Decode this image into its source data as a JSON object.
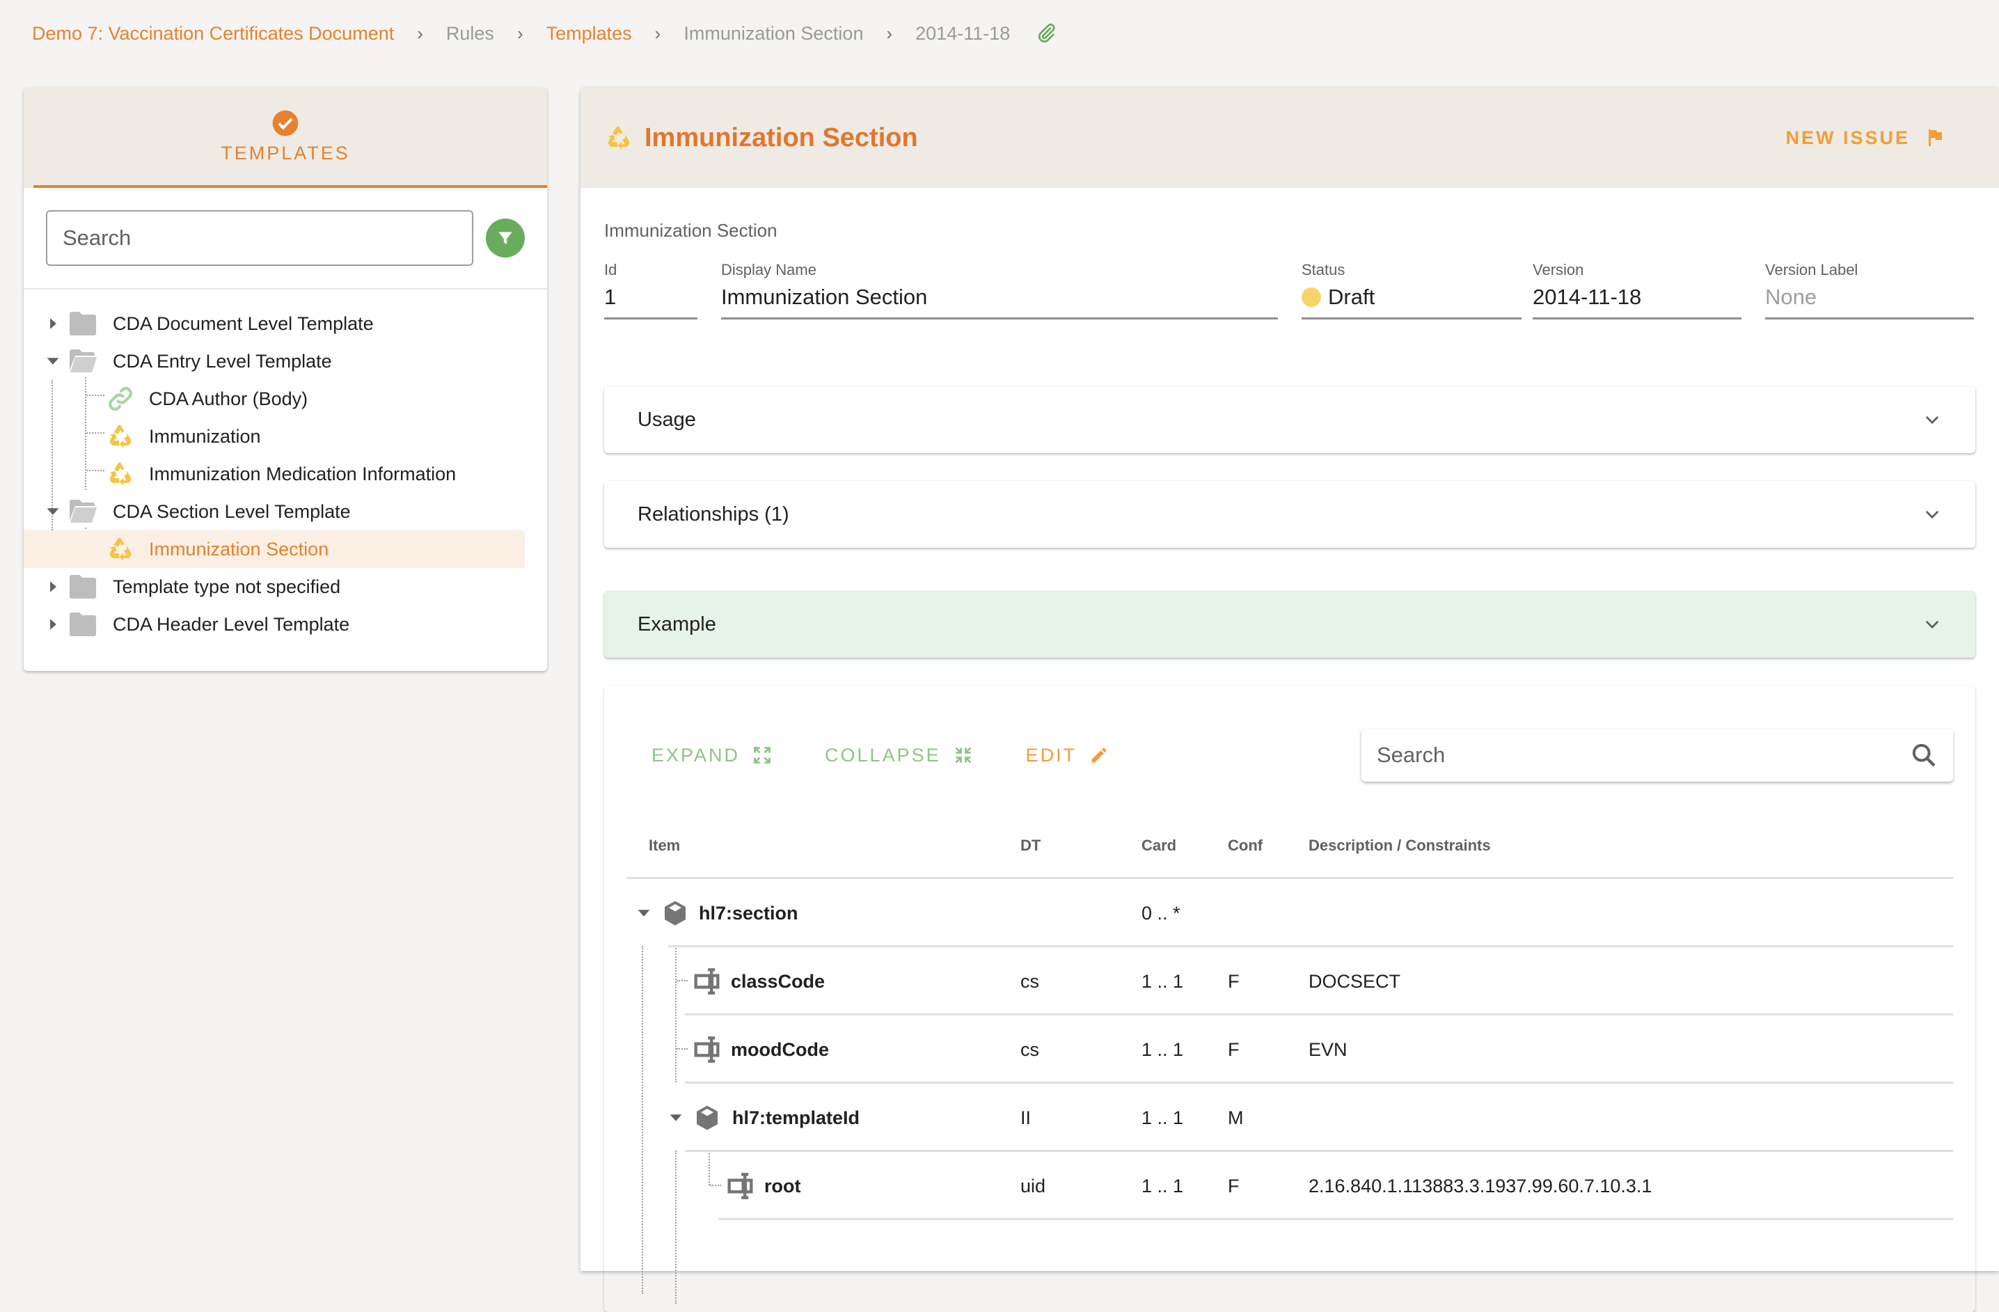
{
  "breadcrumb": {
    "items": [
      {
        "label": "Demo 7: Vaccination Certificates Document",
        "type": "link"
      },
      {
        "label": "Rules",
        "type": "plain"
      },
      {
        "label": "Templates",
        "type": "link"
      },
      {
        "label": "Immunization Section",
        "type": "plain"
      },
      {
        "label": "2014-11-18",
        "type": "plain"
      }
    ],
    "separator": "›",
    "attachment_icon": "paperclip-icon"
  },
  "left_panel": {
    "header_icon": "check-circle-icon",
    "title": "TEMPLATES",
    "search_placeholder": "Search",
    "filter_icon": "filter-icon",
    "tree": [
      {
        "label": "CDA Document Level Template",
        "type": "folder",
        "expanded": false
      },
      {
        "label": "CDA Entry Level Template",
        "type": "folder",
        "expanded": true,
        "children": [
          {
            "label": "CDA Author (Body)",
            "icon": "link-icon"
          },
          {
            "label": "Immunization",
            "icon": "recycle-icon"
          },
          {
            "label": "Immunization Medication Information",
            "icon": "recycle-icon"
          }
        ]
      },
      {
        "label": "CDA Section Level Template",
        "type": "folder",
        "expanded": true,
        "children": [
          {
            "label": "Immunization Section",
            "icon": "recycle-icon",
            "selected": true
          }
        ]
      },
      {
        "label": "Template type not specified",
        "type": "folder",
        "expanded": false
      },
      {
        "label": "CDA Header Level Template",
        "type": "folder",
        "expanded": false
      }
    ]
  },
  "main": {
    "title": "Immunization Section",
    "title_icon": "recycle-icon",
    "new_issue_label": "NEW ISSUE",
    "new_issue_icon": "flag-icon",
    "subtitle": "Immunization Section",
    "fields": {
      "id": {
        "label": "Id",
        "value": "1"
      },
      "display_name": {
        "label": "Display Name",
        "value": "Immunization Section"
      },
      "status": {
        "label": "Status",
        "value": "Draft",
        "color": "#f7d56b"
      },
      "version": {
        "label": "Version",
        "value": "2014-11-18"
      },
      "version_label": {
        "label": "Version Label",
        "value": "None"
      }
    },
    "accordions": [
      {
        "label": "Usage"
      },
      {
        "label": "Relationships (1)"
      },
      {
        "label": "Example"
      }
    ],
    "toolbar": {
      "expand_label": "EXPAND",
      "collapse_label": "COLLAPSE",
      "edit_label": "EDIT",
      "search_placeholder": "Search"
    },
    "table": {
      "columns": [
        "Item",
        "DT",
        "Card",
        "Conf",
        "Description / Constraints"
      ],
      "rows": [
        {
          "name": "hl7:section",
          "kind": "element",
          "depth": 0,
          "expanded": true,
          "dt": "",
          "card": "0 .. *",
          "conf": "",
          "desc": ""
        },
        {
          "name": "classCode",
          "kind": "attribute",
          "depth": 1,
          "dt": "cs",
          "card": "1 .. 1",
          "conf": "F",
          "desc": "DOCSECT"
        },
        {
          "name": "moodCode",
          "kind": "attribute",
          "depth": 1,
          "dt": "cs",
          "card": "1 .. 1",
          "conf": "F",
          "desc": "EVN"
        },
        {
          "name": "hl7:templateId",
          "kind": "element",
          "depth": 1,
          "expanded": true,
          "dt": "II",
          "card": "1 .. 1",
          "conf": "M",
          "desc": ""
        },
        {
          "name": "root",
          "kind": "attribute",
          "depth": 2,
          "dt": "uid",
          "card": "1 .. 1",
          "conf": "F",
          "desc": "2.16.840.1.113883.3.1937.99.60.7.10.3.1"
        }
      ]
    }
  },
  "colors": {
    "accent_orange": "#e5812f",
    "button_orange": "#f29d38",
    "accent_green": "#67ad5b",
    "light_green": "#8ec487",
    "header_bg": "#efebe4",
    "selected_bg": "#fcefe4",
    "example_bg": "#e8f3e8",
    "recycle_yellow": "#f5c445"
  }
}
